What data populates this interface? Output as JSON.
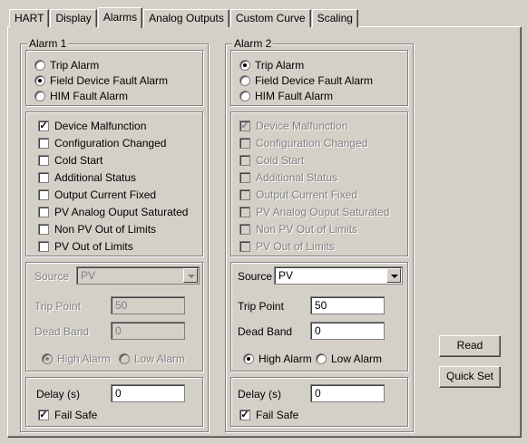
{
  "tabs": [
    "HART",
    "Display",
    "Alarms",
    "Analog Outputs",
    "Custom Curve",
    "Scaling"
  ],
  "active_tab": "Alarms",
  "alarm1": {
    "title": "Alarm 1",
    "types": [
      {
        "label": "Trip Alarm",
        "selected": false
      },
      {
        "label": "Field Device Fault Alarm",
        "selected": true
      },
      {
        "label": "HIM Fault Alarm",
        "selected": false
      }
    ],
    "conditions": [
      {
        "label": "Device Malfunction",
        "checked": true
      },
      {
        "label": "Configuration Changed",
        "checked": false
      },
      {
        "label": "Cold Start",
        "checked": false
      },
      {
        "label": "Additional Status",
        "checked": false
      },
      {
        "label": "Output Current Fixed",
        "checked": false
      },
      {
        "label": "PV Analog Ouput Saturated",
        "checked": false
      },
      {
        "label": "Non PV Out of Limits",
        "checked": false
      },
      {
        "label": "PV Out of Limits",
        "checked": false
      }
    ],
    "source_label": "Source",
    "source_value": "PV",
    "trip_point_label": "Trip Point",
    "trip_point_value": "50",
    "dead_band_label": "Dead Band",
    "dead_band_value": "0",
    "high_alarm_label": "High Alarm",
    "low_alarm_label": "Low Alarm",
    "high_selected": true,
    "delay_label": "Delay (s)",
    "delay_value": "0",
    "fail_safe_label": "Fail Safe",
    "fail_safe_checked": true
  },
  "alarm2": {
    "title": "Alarm 2",
    "types": [
      {
        "label": "Trip Alarm",
        "selected": true
      },
      {
        "label": "Field Device Fault Alarm",
        "selected": false
      },
      {
        "label": "HIM Fault Alarm",
        "selected": false
      }
    ],
    "conditions": [
      {
        "label": "Device Malfunction",
        "checked": true
      },
      {
        "label": "Configuration Changed",
        "checked": false
      },
      {
        "label": "Cold Start",
        "checked": false
      },
      {
        "label": "Additional Status",
        "checked": false
      },
      {
        "label": "Output Current Fixed",
        "checked": false
      },
      {
        "label": "PV Analog Ouput Saturated",
        "checked": false
      },
      {
        "label": "Non PV Out of Limits",
        "checked": false
      },
      {
        "label": "PV Out of Limits",
        "checked": false
      }
    ],
    "source_label": "Source",
    "source_value": "PV",
    "trip_point_label": "Trip Point",
    "trip_point_value": "50",
    "dead_band_label": "Dead Band",
    "dead_band_value": "0",
    "high_alarm_label": "High Alarm",
    "low_alarm_label": "Low Alarm",
    "high_selected": true,
    "delay_label": "Delay (s)",
    "delay_value": "0",
    "fail_safe_label": "Fail Safe",
    "fail_safe_checked": true
  },
  "buttons": {
    "read": "Read",
    "quick_set": "Quick Set"
  }
}
